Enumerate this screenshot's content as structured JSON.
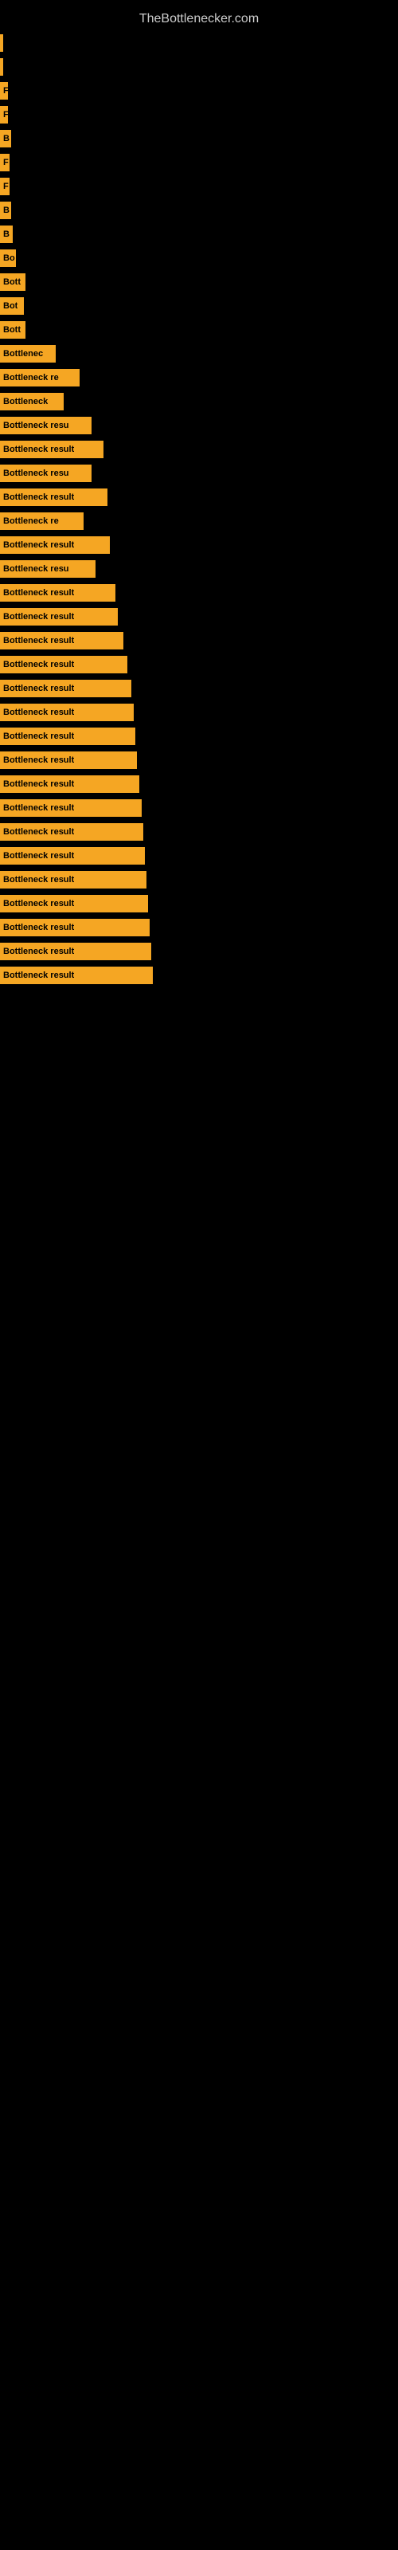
{
  "site": {
    "title": "TheBottlenecker.com"
  },
  "bars": [
    {
      "label": "",
      "width": 4
    },
    {
      "label": "",
      "width": 4
    },
    {
      "label": "F",
      "width": 10
    },
    {
      "label": "F",
      "width": 10
    },
    {
      "label": "B",
      "width": 14
    },
    {
      "label": "F",
      "width": 12
    },
    {
      "label": "F",
      "width": 12
    },
    {
      "label": "B",
      "width": 14
    },
    {
      "label": "B",
      "width": 16
    },
    {
      "label": "Bo",
      "width": 20
    },
    {
      "label": "Bott",
      "width": 32
    },
    {
      "label": "Bot",
      "width": 30
    },
    {
      "label": "Bott",
      "width": 32
    },
    {
      "label": "Bottlenec",
      "width": 70
    },
    {
      "label": "Bottleneck re",
      "width": 100
    },
    {
      "label": "Bottleneck",
      "width": 80
    },
    {
      "label": "Bottleneck resu",
      "width": 115
    },
    {
      "label": "Bottleneck result",
      "width": 130
    },
    {
      "label": "Bottleneck resu",
      "width": 115
    },
    {
      "label": "Bottleneck result",
      "width": 135
    },
    {
      "label": "Bottleneck re",
      "width": 105
    },
    {
      "label": "Bottleneck result",
      "width": 138
    },
    {
      "label": "Bottleneck resu",
      "width": 120
    },
    {
      "label": "Bottleneck result",
      "width": 145
    },
    {
      "label": "Bottleneck result",
      "width": 148
    },
    {
      "label": "Bottleneck result",
      "width": 155
    },
    {
      "label": "Bottleneck result",
      "width": 160
    },
    {
      "label": "Bottleneck result",
      "width": 165
    },
    {
      "label": "Bottleneck result",
      "width": 168
    },
    {
      "label": "Bottleneck result",
      "width": 170
    },
    {
      "label": "Bottleneck result",
      "width": 172
    },
    {
      "label": "Bottleneck result",
      "width": 175
    },
    {
      "label": "Bottleneck result",
      "width": 178
    },
    {
      "label": "Bottleneck result",
      "width": 180
    },
    {
      "label": "Bottleneck result",
      "width": 182
    },
    {
      "label": "Bottleneck result",
      "width": 184
    },
    {
      "label": "Bottleneck result",
      "width": 186
    },
    {
      "label": "Bottleneck result",
      "width": 188
    },
    {
      "label": "Bottleneck result",
      "width": 190
    },
    {
      "label": "Bottleneck result",
      "width": 192
    }
  ]
}
